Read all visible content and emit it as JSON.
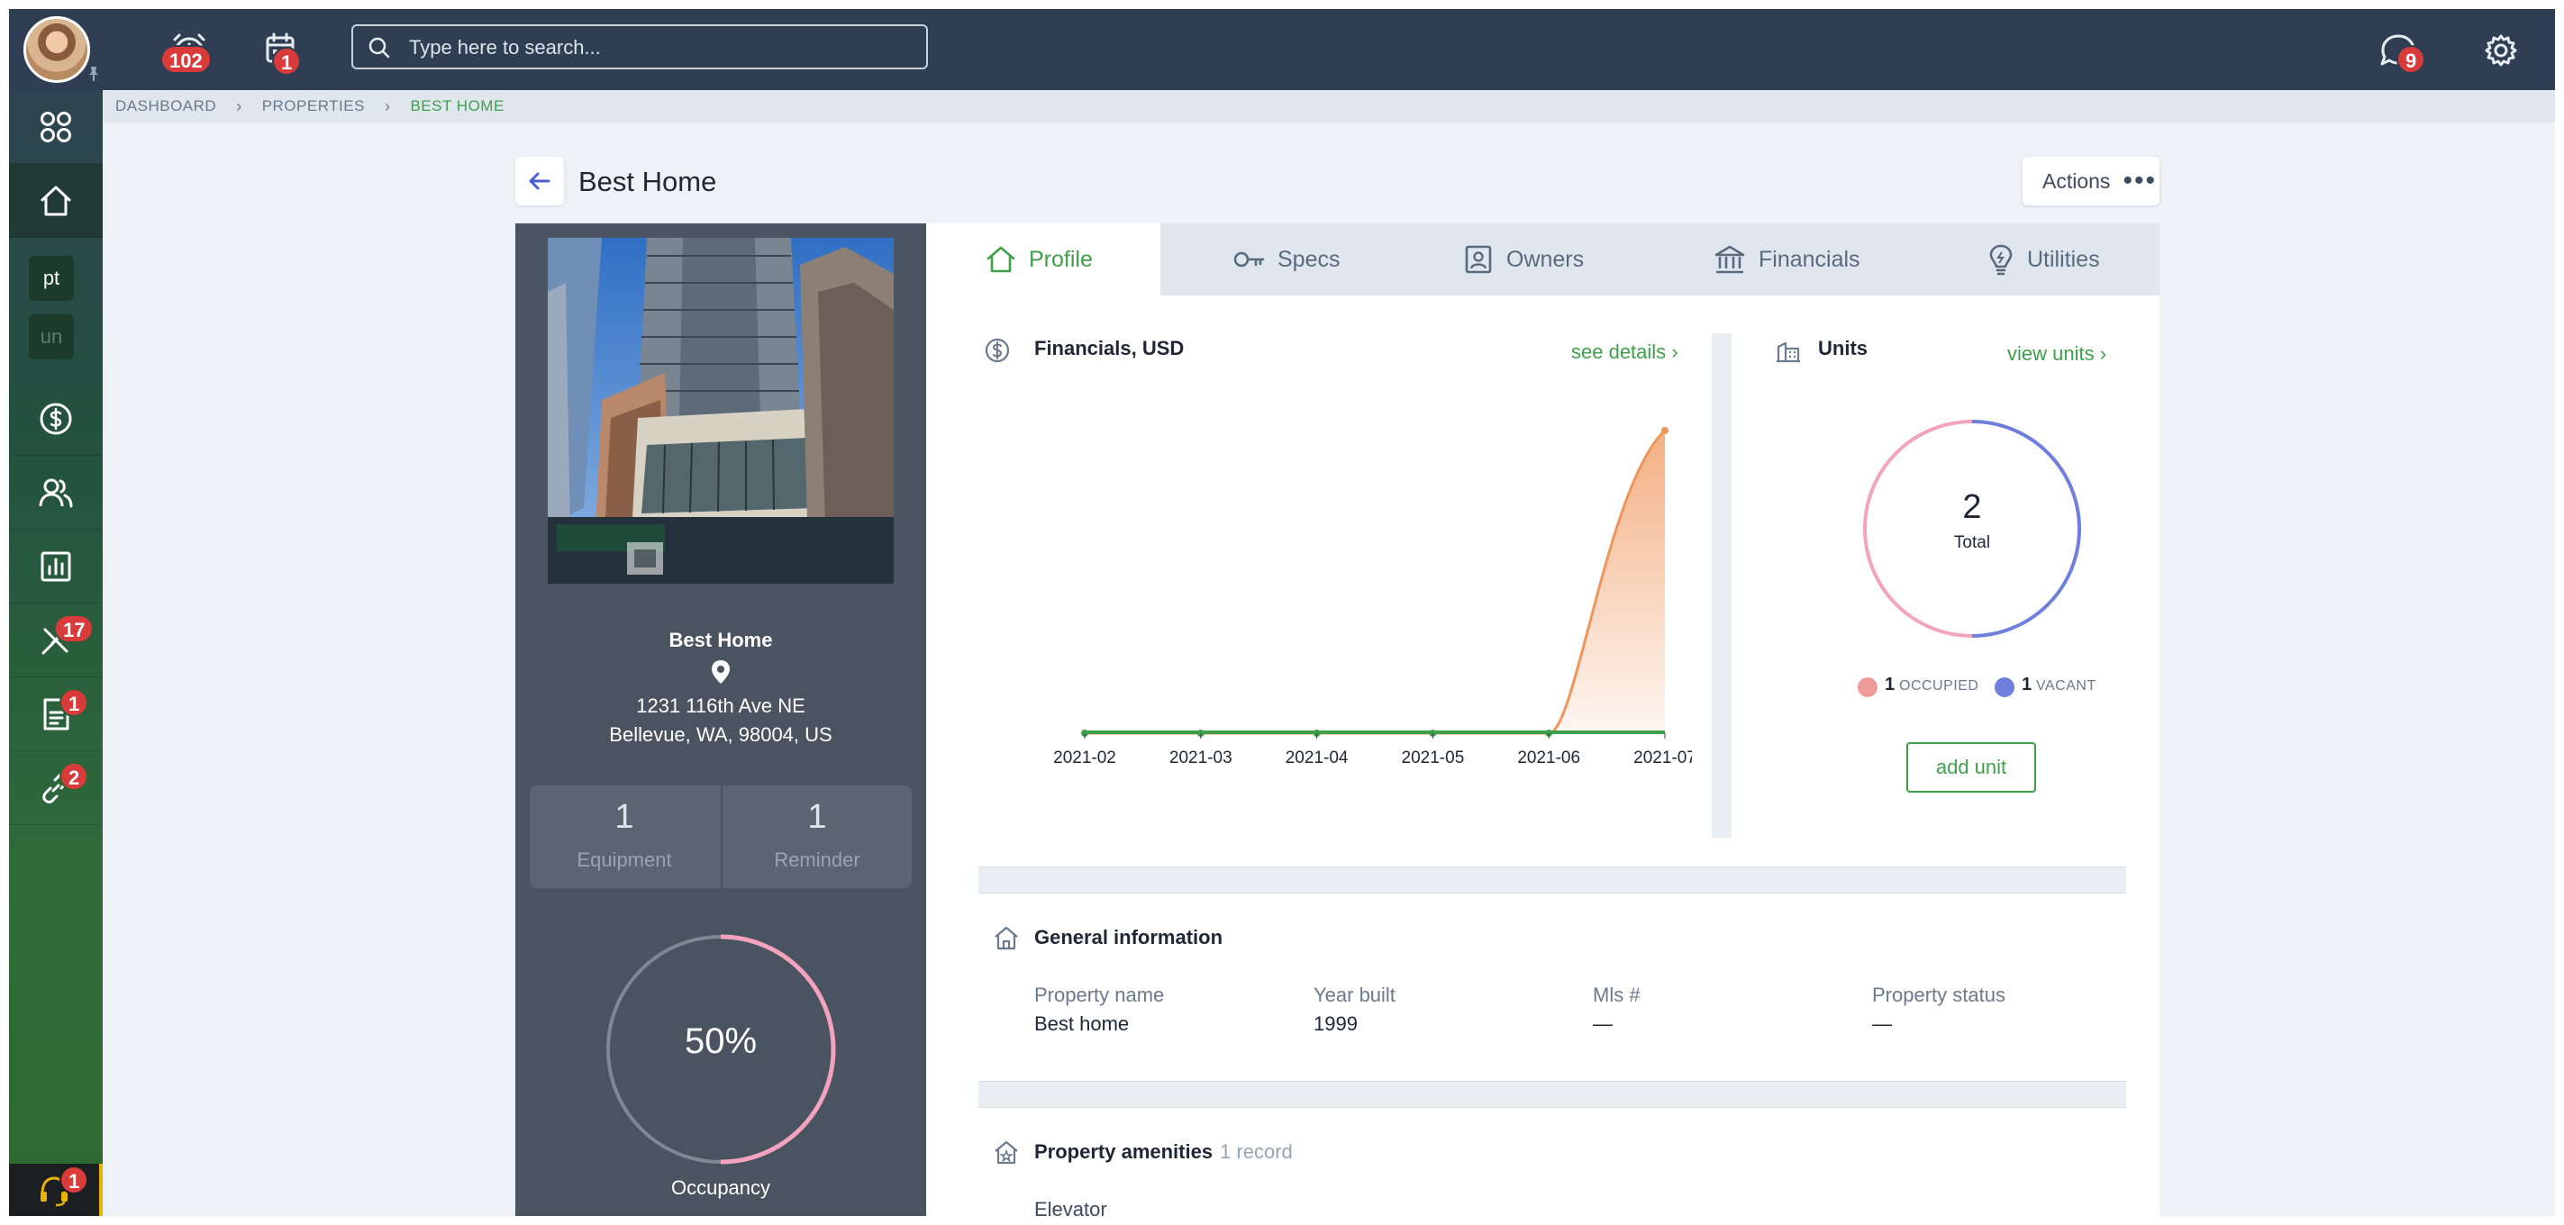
{
  "topbar": {
    "alarm_badge": "102",
    "calendar_badge": "1",
    "search_placeholder": "Type here to search...",
    "messages_badge": "9"
  },
  "sidebar": {
    "tags": [
      "pt",
      "un"
    ],
    "tools_badge": "17",
    "docs_badge": "1",
    "links_badge": "2",
    "support_badge": "1"
  },
  "breadcrumb": [
    "DASHBOARD",
    "PROPERTIES",
    "BEST HOME"
  ],
  "page": {
    "title": "Best Home",
    "actions_label": "Actions"
  },
  "property_card": {
    "name": "Best Home",
    "address_line1": "1231 116th Ave NE",
    "address_line2": "Bellevue, WA, 98004, US",
    "equipment_count": "1",
    "equipment_label": "Equipment",
    "reminder_count": "1",
    "reminder_label": "Reminder",
    "occupancy_value": "50%",
    "occupancy_fraction": 0.5,
    "occupancy_label": "Occupancy"
  },
  "tabs": [
    "Profile",
    "Specs",
    "Owners",
    "Financials",
    "Utilities"
  ],
  "financials": {
    "title": "Financials, USD",
    "link": "see details"
  },
  "chart_data": {
    "type": "area",
    "categories": [
      "2021-02",
      "2021-03",
      "2021-04",
      "2021-05",
      "2021-06",
      "2021-07"
    ],
    "series": [
      {
        "values": [
          0,
          0,
          0,
          0,
          0,
          100
        ],
        "color": "#f0955a"
      },
      {
        "values": [
          0,
          0,
          0,
          0,
          0,
          0
        ],
        "color": "#3fa04a"
      }
    ],
    "grid": false,
    "yaxis_labels": false
  },
  "units": {
    "title": "Units",
    "link": "view units",
    "total": "2",
    "total_label": "Total",
    "occupied_count": "1",
    "occupied_label": "OCCUPIED",
    "occupied_color": "#f4a3bd",
    "vacant_count": "1",
    "vacant_label": "VACANT",
    "vacant_color": "#6f7fdd",
    "add_label": "add unit"
  },
  "general_info": {
    "title": "General information",
    "fields": [
      {
        "label": "Property name",
        "value": "Best home"
      },
      {
        "label": "Year built",
        "value": "1999"
      },
      {
        "label": "Mls #",
        "value": "—"
      },
      {
        "label": "Property status",
        "value": "—"
      }
    ]
  },
  "amenities": {
    "title": "Property amenities",
    "count": "1 record",
    "items": [
      "Elevator"
    ]
  }
}
